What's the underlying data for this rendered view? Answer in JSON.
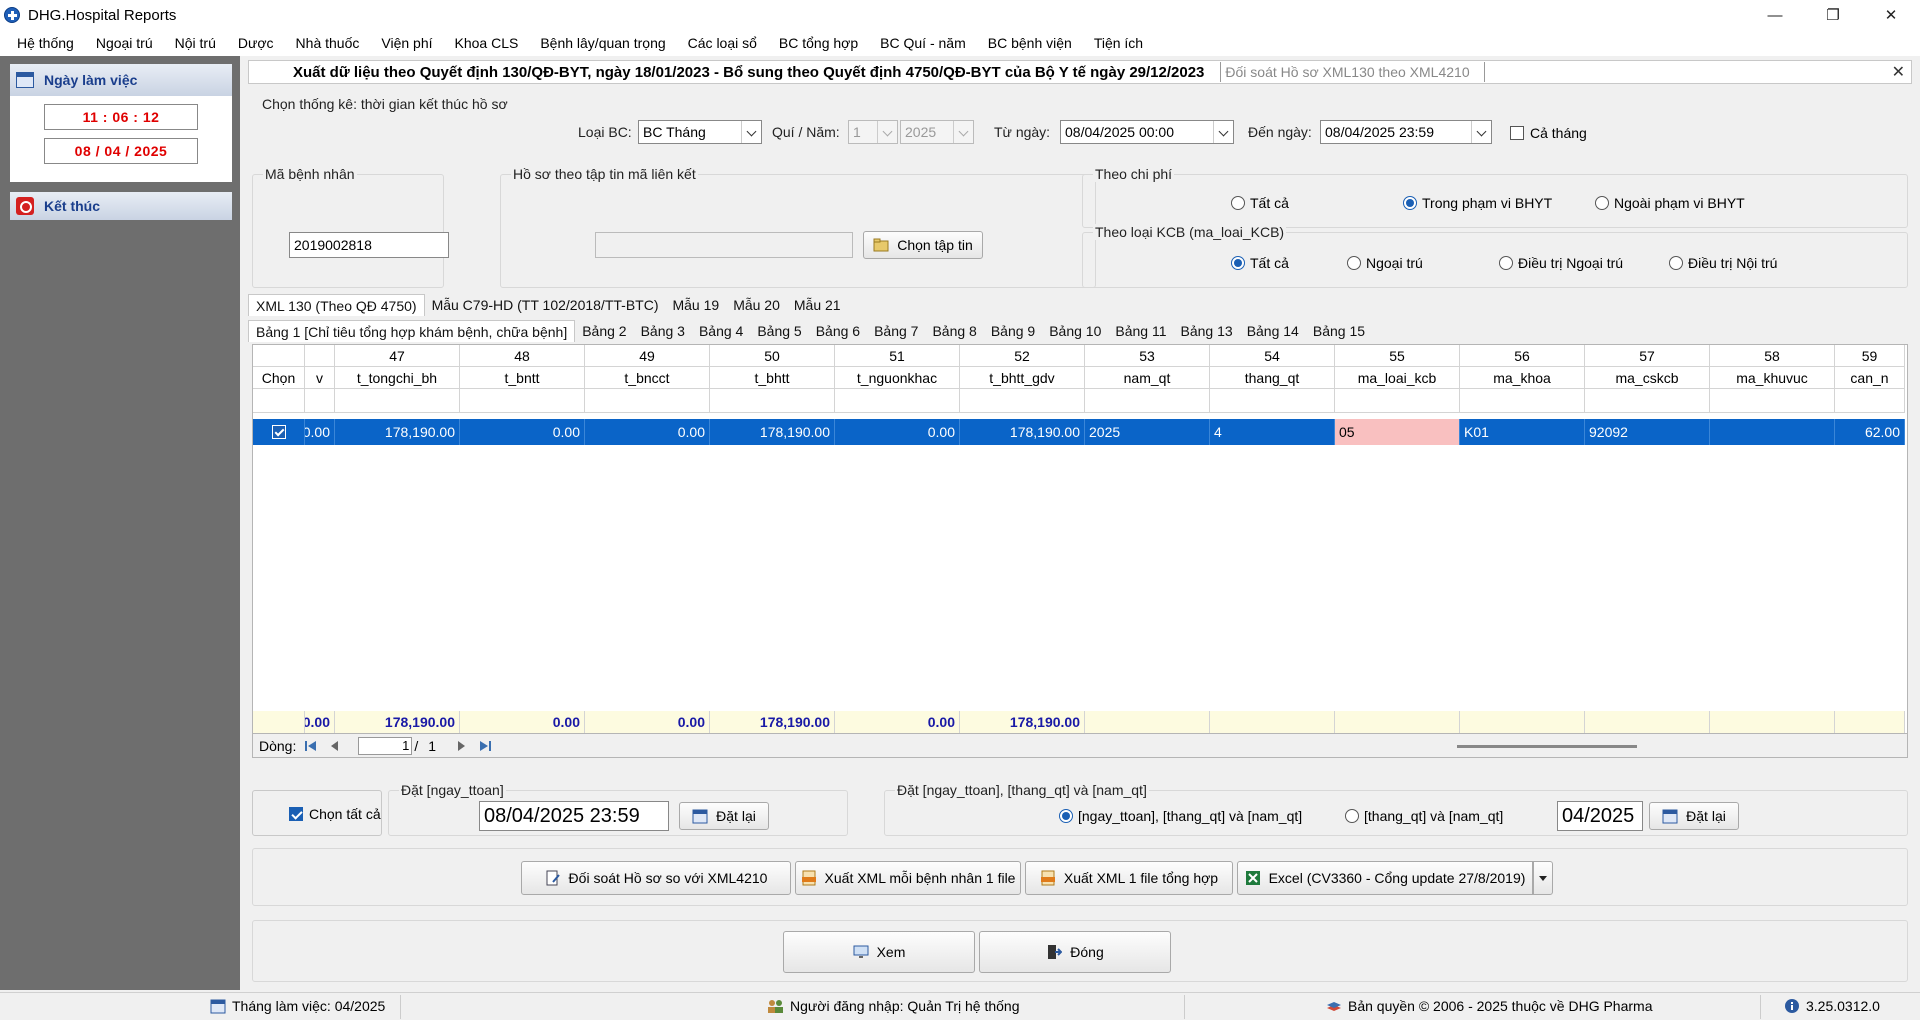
{
  "window": {
    "title": "DHG.Hospital Reports",
    "minimize": "—",
    "restore": "❐",
    "close": "✕"
  },
  "menu": [
    "Hệ thống",
    "Ngoại trú",
    "Nội trú",
    "Dược",
    "Nhà thuốc",
    "Viện phí",
    "Khoa CLS",
    "Bệnh lây/quan trọng",
    "Các loại sổ",
    "BC tổng hợp",
    "BC Quí - năm",
    "BC bệnh viện",
    "Tiện ích"
  ],
  "sidebar": {
    "workday_label": "Ngày làm việc",
    "time": "11 : 06 : 12",
    "date": "08 / 04 / 2025",
    "exit_label": "Kết thúc"
  },
  "header": {
    "title": "Xuất dữ liệu theo Quyết định 130/QĐ-BYT, ngày 18/01/2023 - Bổ sung theo Quyết định 4750/QĐ-BYT của Bộ Y tế ngày 29/12/2023",
    "subtitle": "Đối soát Hồ sơ XML130 theo XML4210",
    "close": "✕"
  },
  "filters": {
    "group_label": "Chọn thống kê: thời gian kết thúc hồ sơ",
    "report_type_label": "Loại BC:",
    "report_type_value": "BC Tháng",
    "quarter_year_label": "Quí / Năm:",
    "quarter_value": "1",
    "year_value": "2025",
    "from_label": "Từ ngày:",
    "from_value": "08/04/2025 00:00",
    "to_label": "Đến ngày:",
    "to_value": "08/04/2025 23:59",
    "whole_month_label": "Cả tháng"
  },
  "patient": {
    "label": "Mã bệnh nhân",
    "value": "2019002818"
  },
  "file_link": {
    "label": "Hồ sơ theo tập tin mã liên kết",
    "value": "",
    "choose_button": "Chọn tập tin"
  },
  "cost": {
    "label": "Theo chi phí",
    "options": [
      "Tất cả",
      "Trong phạm vi BHYT",
      "Ngoài phạm vi BHYT"
    ],
    "selected": 1
  },
  "kcb": {
    "label": "Theo loại KCB (ma_loai_KCB)",
    "options": [
      "Tất cả",
      "Ngoại trú",
      "Điều trị Ngoại trú",
      "Điều trị Nội trú"
    ],
    "selected": 0
  },
  "tabs_main": [
    "XML 130 (Theo QĐ 4750)",
    "Mẫu C79-HD (TT 102/2018/TT-BTC)",
    "Mẫu 19",
    "Mẫu 20",
    "Mẫu 21"
  ],
  "tabs_sub": [
    "Bảng 1 [Chỉ tiêu tổng hợp khám bệnh, chữa bệnh]",
    "Bảng 2",
    "Bảng 3",
    "Bảng 4",
    "Bảng 5",
    "Bảng 6",
    "Bảng 7",
    "Bảng 8",
    "Bảng 9",
    "Bảng 10",
    "Bảng 11",
    "Bảng 13",
    "Bảng 14",
    "Bảng 15"
  ],
  "grid": {
    "select_header": "Chọn",
    "col_numbers": [
      "",
      "47",
      "48",
      "49",
      "50",
      "51",
      "52",
      "53",
      "54",
      "55",
      "56",
      "57",
      "58",
      "59"
    ],
    "col_names": [
      "v",
      "t_tongchi_bh",
      "t_bntt",
      "t_bncct",
      "t_bhtt",
      "t_nguonkhac",
      "t_bhtt_gdv",
      "nam_qt",
      "thang_qt",
      "ma_loai_kcb",
      "ma_khoa",
      "ma_cskcb",
      "ma_khuvuc",
      "can_n"
    ],
    "row": [
      "0.00",
      "178,190.00",
      "0.00",
      "0.00",
      "178,190.00",
      "0.00",
      "178,190.00",
      "2025",
      "4",
      "05",
      "K01",
      "92092",
      "",
      "62.00"
    ],
    "totals": [
      "0.00",
      "178,190.00",
      "0.00",
      "0.00",
      "178,190.00",
      "0.00",
      "178,190.00",
      "",
      "",
      "",
      "",
      "",
      "",
      ""
    ]
  },
  "navigator": {
    "label": "Dòng:",
    "page": "1",
    "sep": "/",
    "total": "1"
  },
  "bottom": {
    "select_all_label": "Chọn tất cả",
    "set_date_label": "Đặt [ngay_ttoan]",
    "set_date_value": "08/04/2025 23:59",
    "reset_label": "Đặt lại",
    "set_multi_label": "Đặt  [ngay_ttoan], [thang_qt] và [nam_qt]",
    "multi_options": [
      "[ngay_ttoan], [thang_qt] và [nam_qt]",
      "[thang_qt] và [nam_qt]"
    ],
    "multi_selected": 0,
    "month_value": "04/2025",
    "reset_label2": "Đặt lại"
  },
  "actions": {
    "reconcile": "Đối soát Hồ sơ so với XML4210",
    "export_per_patient": "Xuất XML mỗi bệnh nhân 1 file",
    "export_combined": "Xuất XML 1 file tổng hợp",
    "excel": "Excel (CV3360 - Cổng update 27/8/2019)",
    "view": "Xem",
    "close": "Đóng"
  },
  "status": {
    "work_month": "Tháng làm việc: 04/2025",
    "user": "Người đăng nhập: Quản Trị hệ thống",
    "copyright": "Bản quyền © 2006 - 2025 thuộc về DHG Pharma",
    "version": "3.25.0312.0"
  }
}
